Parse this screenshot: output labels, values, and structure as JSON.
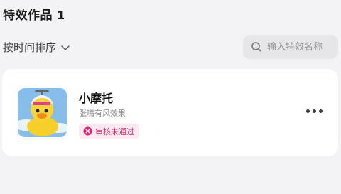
{
  "header": {
    "title": "特效作品",
    "count": "1"
  },
  "sort": {
    "label": "按时间排序",
    "icon": "chevron-down-icon"
  },
  "search": {
    "placeholder": "输入特效名称",
    "icon": "search-icon"
  },
  "effects": [
    {
      "name": "小摩托",
      "description": "张嘴有风效果",
      "status": "审核未通过",
      "status_icon": "x-circle-icon",
      "status_color": "#e2276f",
      "thumbnail": "duck-with-helmet-thumbnail",
      "more_icon": "more-horizontal-icon"
    }
  ]
}
